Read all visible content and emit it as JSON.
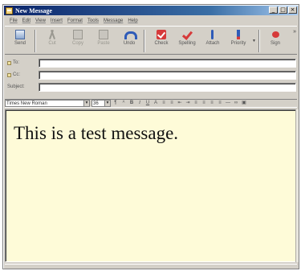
{
  "window": {
    "title": "New Message"
  },
  "menu": [
    "File",
    "Edit",
    "View",
    "Insert",
    "Format",
    "Tools",
    "Message",
    "Help"
  ],
  "toolbar": {
    "send": "Send",
    "cut": "Cut",
    "copy": "Copy",
    "paste": "Paste",
    "undo": "Undo",
    "check": "Check",
    "spelling": "Spelling",
    "attach": "Attach",
    "priority": "Priority",
    "sign": "Sign"
  },
  "address": {
    "to_label": "To:",
    "cc_label": "Cc:",
    "subject_label": "Subject:",
    "to_value": "",
    "cc_value": "",
    "subject_value": ""
  },
  "format": {
    "font": "Times New Roman",
    "size": "36",
    "buttons": [
      "B",
      "I",
      "U",
      "A"
    ]
  },
  "body": {
    "message": "This is a test message."
  },
  "colors": {
    "titlebar": "#0a246a",
    "body_background": "#fefbd8",
    "chrome": "#d4d0c8"
  },
  "icons": [
    "send-icon",
    "cut-icon",
    "copy-icon",
    "paste-icon",
    "undo-icon",
    "check-icon",
    "spelling-icon",
    "attach-icon",
    "priority-icon",
    "sign-icon"
  ]
}
